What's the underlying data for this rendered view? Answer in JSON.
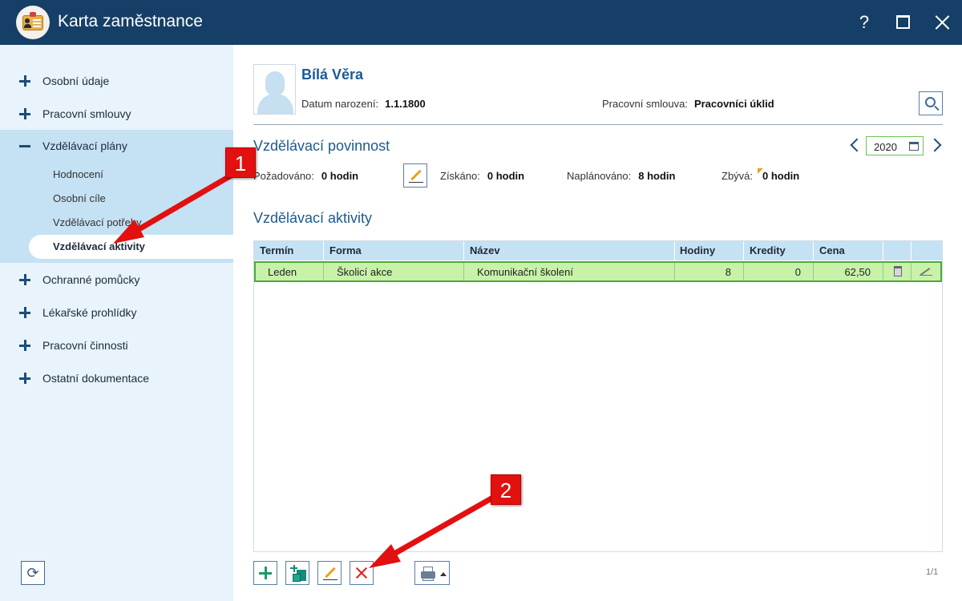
{
  "window": {
    "title": "Karta zaměstnance",
    "help_label": "?"
  },
  "sidebar": {
    "items": [
      {
        "label": "Osobní údaje"
      },
      {
        "label": "Pracovní smlouvy"
      },
      {
        "label": "Vzdělávací plány"
      },
      {
        "label": "Ochranné pomůcky"
      },
      {
        "label": "Lékařské prohlídky"
      },
      {
        "label": "Pracovní činnosti"
      },
      {
        "label": "Ostatní dokumentace"
      }
    ],
    "sub_items": [
      {
        "label": "Hodnocení"
      },
      {
        "label": "Osobní cíle"
      },
      {
        "label": "Vzdělávací potřeby"
      },
      {
        "label": "Vzdělávací aktivity"
      }
    ],
    "refresh_icon": "⟳"
  },
  "employee": {
    "name": "Bílá Věra",
    "birth_label": "Datum narození:",
    "birth_value": "1.1.1800",
    "contract_label": "Pracovní smlouva:",
    "contract_value": "Pracovníci úklid"
  },
  "obligation": {
    "title": "Vzdělávací povinnost",
    "year": "2020",
    "required_label": "Požadováno:",
    "required_value": "0 hodin",
    "earned_label": "Získáno:",
    "earned_value": "0 hodin",
    "planned_label": "Naplánováno:",
    "planned_value": "8 hodin",
    "remaining_label": "Zbývá:",
    "remaining_value": "0 hodin"
  },
  "activities": {
    "title": "Vzdělávací aktivity",
    "columns": {
      "termin": "Termín",
      "forma": "Forma",
      "nazev": "Název",
      "hodiny": "Hodiny",
      "kredity": "Kredity",
      "cena": "Cena"
    },
    "rows": [
      {
        "termin": "Leden",
        "forma": "Školicí akce",
        "nazev": "Komunikační školení",
        "hodiny": "8",
        "kredity": "0",
        "cena": "62,50"
      }
    ],
    "pager": "1/1"
  },
  "annotations": {
    "badge1": "1",
    "badge2": "2"
  },
  "colors": {
    "titlebar": "#163f67",
    "accent": "#1d5a8e",
    "selected_row": "#c8f2a8",
    "annotation": "#e31010"
  }
}
